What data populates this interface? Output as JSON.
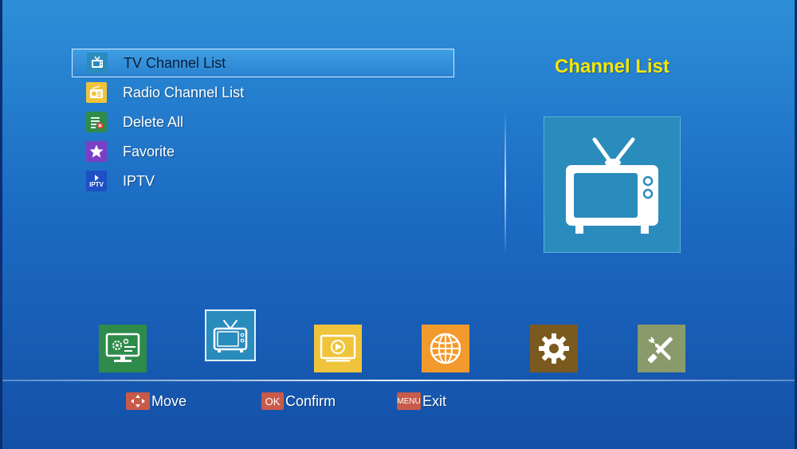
{
  "menu": {
    "items": [
      {
        "label": "TV Channel List",
        "icon": "tv-icon",
        "selected": true
      },
      {
        "label": "Radio Channel List",
        "icon": "radio-icon",
        "selected": false
      },
      {
        "label": "Delete All",
        "icon": "delete-list-icon",
        "selected": false
      },
      {
        "label": "Favorite",
        "icon": "star-icon",
        "selected": false
      },
      {
        "label": "IPTV",
        "icon": "iptv-icon",
        "icon_text": "IPTV",
        "selected": false
      }
    ]
  },
  "preview": {
    "title": "Channel List",
    "icon": "tv-icon"
  },
  "dock": {
    "tiles": [
      {
        "icon": "system-settings-icon",
        "color": "#2e8b4a",
        "selected": false
      },
      {
        "icon": "tv-icon",
        "color": "#2a8bbd",
        "selected": true
      },
      {
        "icon": "media-player-icon",
        "color": "#f0c43a",
        "selected": false
      },
      {
        "icon": "globe-icon",
        "color": "#f39a2c",
        "selected": false
      },
      {
        "icon": "gear-icon",
        "color": "#7a5a1e",
        "selected": false
      },
      {
        "icon": "tools-icon",
        "color": "#8a9a6a",
        "selected": false
      }
    ]
  },
  "hints": {
    "move": {
      "key_icon": "arrows-key-icon",
      "label": "Move"
    },
    "confirm": {
      "key": "OK",
      "label": "Confirm"
    },
    "exit": {
      "key": "MENU",
      "label": "Exit"
    }
  },
  "colors": {
    "title_yellow": "#f7e600",
    "hint_key_red": "#c85a4a"
  }
}
